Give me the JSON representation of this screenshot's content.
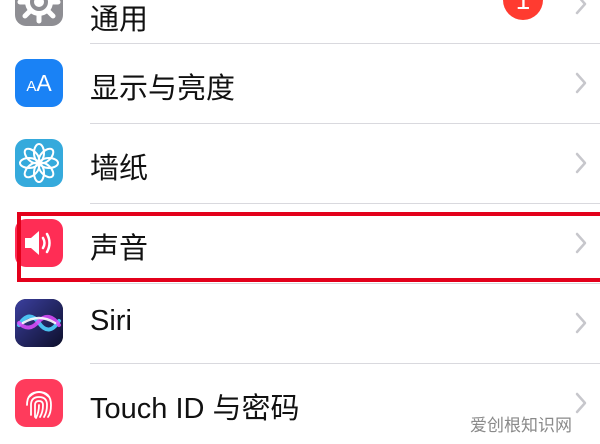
{
  "settings": {
    "rows": [
      {
        "id": "general",
        "label": "通用",
        "icon": "gear-icon",
        "icon_color": "#8e8e93",
        "badge": "1"
      },
      {
        "id": "display",
        "label": "显示与亮度",
        "icon": "display-aa-icon",
        "icon_color": "#1a82f5",
        "icon_text": "AA"
      },
      {
        "id": "wallpaper",
        "label": "墙纸",
        "icon": "flower-icon",
        "icon_color": "#35aadc"
      },
      {
        "id": "sounds",
        "label": "声音",
        "icon": "speaker-icon",
        "icon_color": "#ff2d55",
        "highlighted": true
      },
      {
        "id": "siri",
        "label": "Siri",
        "icon": "siri-icon",
        "icon_color": "#1b1c3a"
      },
      {
        "id": "touchid",
        "label": "Touch ID 与密码",
        "icon": "fingerprint-icon",
        "icon_color": "#ff3b5c"
      }
    ]
  },
  "highlight_color": "#e3001b",
  "watermark": "爱创根知识网"
}
